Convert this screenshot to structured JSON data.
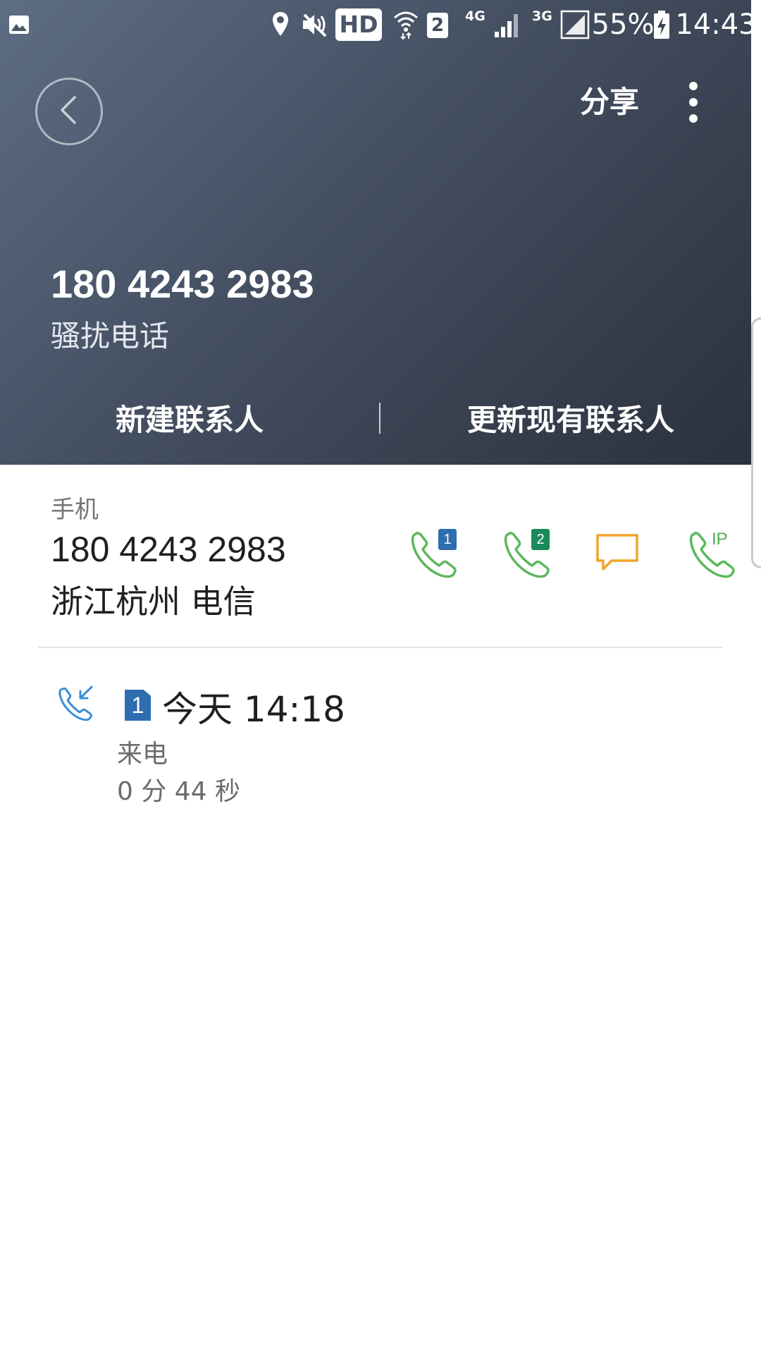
{
  "status_bar": {
    "hd": "HD",
    "wifi_badge": "2",
    "net_4g": "4G",
    "net_3g": "3G",
    "battery_percent": "55%",
    "time": "14:43"
  },
  "header": {
    "share_label": "分享",
    "number": "180 4243 2983",
    "tag": "骚扰电话",
    "new_contact_label": "新建联系人",
    "update_contact_label": "更新现有联系人"
  },
  "phone": {
    "type": "手机",
    "number": "180 4243 2983",
    "location": "浙江杭州 电信",
    "actions": {
      "sim1_badge": "1",
      "sim2_badge": "2",
      "ip_label": "IP"
    }
  },
  "call_log": {
    "sim": "1",
    "time": "今天 14:18",
    "type": "来电",
    "duration": "0 分 44 秒"
  },
  "colors": {
    "call_green": "#5cb85c",
    "sim1_blue": "#2f6db0",
    "sim2_green": "#1b8a5a",
    "message_orange": "#f0a52c",
    "incoming_blue": "#3a8ed8"
  }
}
